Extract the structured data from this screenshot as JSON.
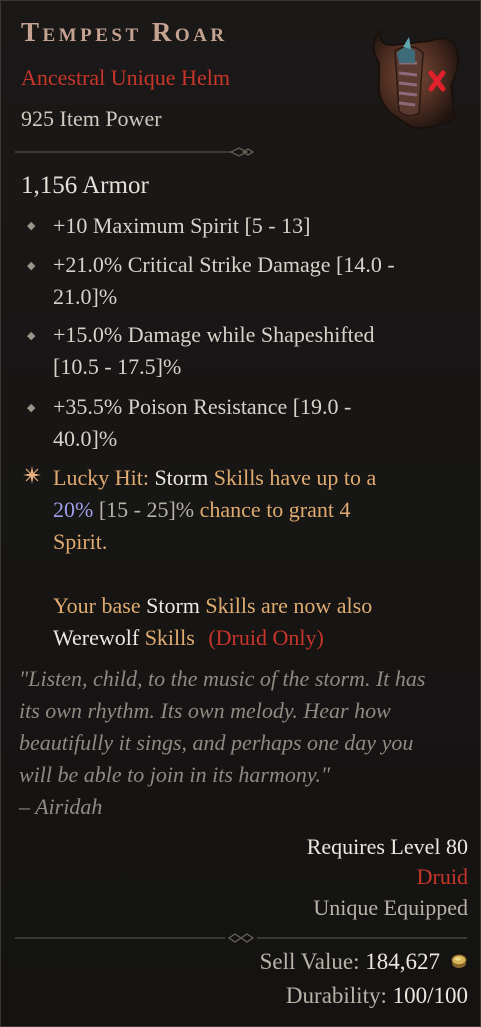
{
  "item": {
    "name": "Tempest Roar",
    "type": "Ancestral Unique Helm",
    "item_power": "925 Item Power",
    "icon": "helm-icon"
  },
  "armor": "1,156 Armor",
  "affixes": [
    {
      "line1": "+10 Maximum Spirit [5 - 13]",
      "line2": ""
    },
    {
      "line1": "+21.0% Critical Strike Damage [14.0 -",
      "line2": "21.0]%"
    },
    {
      "line1": "+15.0% Damage while Shapeshifted",
      "line2": "[10.5 - 17.5]%"
    },
    {
      "line1": "+35.5% Poison Resistance [19.0 -",
      "line2": "40.0]%"
    }
  ],
  "unique_power": {
    "lucky_hit": "Lucky Hit:",
    "storm1": "Storm",
    "t1": "Skills have up to a",
    "pct": "20%",
    "range": "[15 - 25]%",
    "t2": "chance to grant 4",
    "t3": "Spirit.",
    "t4": "Your base",
    "storm2": "Storm",
    "t5": "Skills are now also",
    "werewolf": "Werewolf",
    "skills": "Skills",
    "druid_only": "(Druid Only)"
  },
  "flavor": [
    "\"Listen, child, to the music of the storm. It has",
    "its own rhythm. Its own melody. Hear how",
    "beautifully it sings, and perhaps one day you",
    "will be able to join in its harmony.\"",
    "– Airidah"
  ],
  "requirements": {
    "level": "Requires Level 80",
    "class": "Druid",
    "unique": "Unique Equipped"
  },
  "footer": {
    "sell_label": "Sell Value:",
    "sell_value": "184,627",
    "durability_label": "Durability:",
    "durability_value": "100/100"
  },
  "colors": {
    "title": "#c6a391",
    "unique_red": "#c8352a",
    "affix_orange": "#e0ab70",
    "value_blue": "#9f9ee8"
  }
}
